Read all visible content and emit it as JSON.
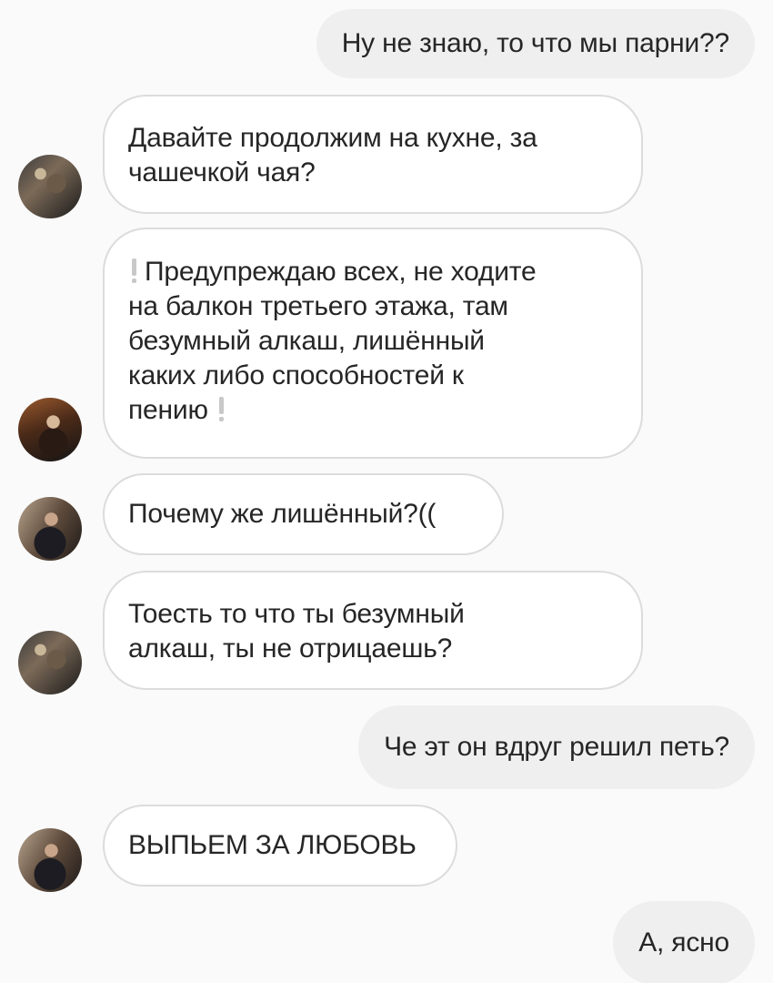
{
  "messages": [
    {
      "id": "m1",
      "dir": "out",
      "text": "Ну не знаю, то что мы парни??"
    },
    {
      "id": "m2",
      "dir": "in",
      "avatar": "avatar-1",
      "text": "Давайте продолжим на кухне, за\nчашечкой чая?"
    },
    {
      "id": "m3",
      "dir": "in",
      "avatar": "avatar-2",
      "text": "Предупреждаю всех, не ходите\nна балкон третьего этажа, там\nбезумный алкаш, лишённый\nкаких либо способностей к\nпению",
      "icons": [
        "exclamation-icon",
        "exclamation-icon"
      ]
    },
    {
      "id": "m4",
      "dir": "in",
      "avatar": "avatar-3",
      "text": "Почему же лишённый?(("
    },
    {
      "id": "m5",
      "dir": "in",
      "avatar": "avatar-1",
      "text": "Тоесть то что ты безумный\nалкаш, ты не отрицаешь?"
    },
    {
      "id": "m6",
      "dir": "out",
      "text": "Че эт он вдруг решил петь?"
    },
    {
      "id": "m7",
      "dir": "in",
      "avatar": "avatar-3",
      "text": "ВЫПЬЕМ ЗА ЛЮБОВЬ"
    },
    {
      "id": "m8",
      "dir": "out",
      "text": "А, ясно"
    }
  ],
  "colors": {
    "background": "#fafafa",
    "incoming_bubble": "#ffffff",
    "incoming_border": "#dcdcdc",
    "outgoing_bubble": "#efefef",
    "text": "#262626",
    "warning_icon": "#c8c8c8"
  }
}
